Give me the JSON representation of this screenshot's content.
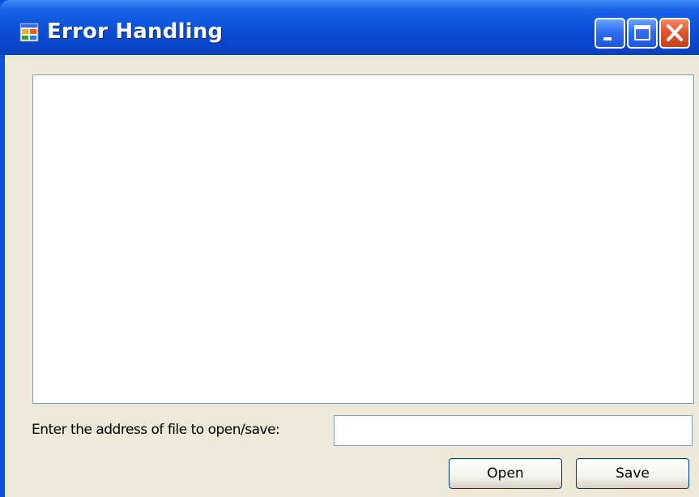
{
  "window": {
    "title": "Error Handling",
    "icon": "app-window-icon",
    "controls": {
      "minimize_icon": "minimize-icon",
      "maximize_icon": "maximize-icon",
      "close_icon": "close-icon"
    }
  },
  "content": {
    "main_text": "",
    "file_label": "Enter the address of file to open/save:",
    "file_input_value": "",
    "open_label": "Open",
    "save_label": "Save"
  },
  "colors": {
    "titlebar": "#0a53d8",
    "client_bg": "#ece9d8",
    "close_button": "#e2562c",
    "input_border": "#7f9db9"
  }
}
